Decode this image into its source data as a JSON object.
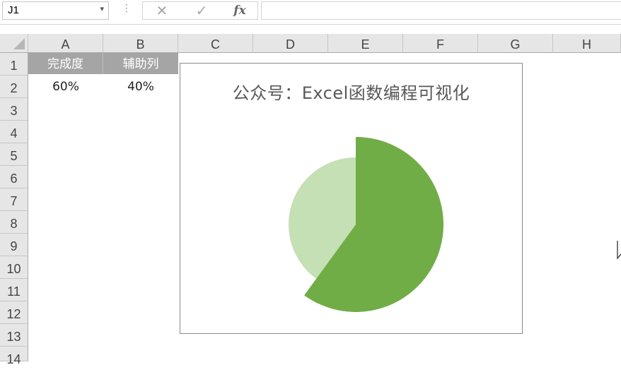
{
  "formula_bar": {
    "name_box": "J1",
    "cancel_icon": "✕",
    "enter_icon": "✓",
    "fx_label": "fx",
    "formula": ""
  },
  "columns": [
    "A",
    "B",
    "C",
    "D",
    "E",
    "F",
    "G",
    "H"
  ],
  "rows": [
    "1",
    "2",
    "3",
    "4",
    "5",
    "6",
    "7",
    "8",
    "9",
    "10",
    "11",
    "12",
    "13",
    "14"
  ],
  "cells": {
    "A1": "完成度",
    "B1": "辅助列",
    "A2": "60%",
    "B2": "40%"
  },
  "colors": {
    "header_fill": "#a5a5a5",
    "primary_slice": "#70ad47",
    "secondary_slice": "#c5e0b4"
  },
  "chart_data": {
    "type": "pie",
    "title": "公众号：Excel函数编程可视化",
    "categories": [
      "完成度",
      "辅助列"
    ],
    "values": [
      0.6,
      0.4
    ],
    "colors": [
      "#70ad47",
      "#c5e0b4"
    ],
    "exploded": "完成度 slice enlarged",
    "start_angle_deg": 0
  }
}
